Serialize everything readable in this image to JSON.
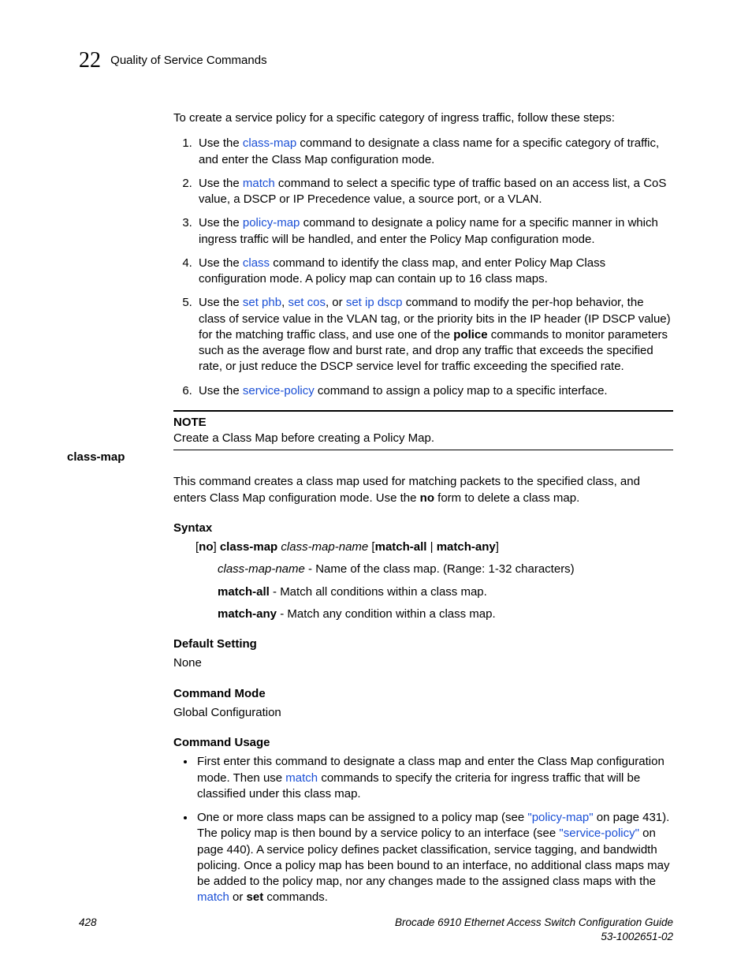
{
  "header": {
    "chapterNumber": "22",
    "title": "Quality of Service Commands"
  },
  "intro": "To create a service policy for a specific category of ingress traffic, follow these steps:",
  "steps": {
    "s1a": "Use the ",
    "s1link": "class-map",
    "s1b": " command to designate a class name for a specific category of traffic, and enter the Class Map configuration mode.",
    "s2a": "Use the ",
    "s2link": "match",
    "s2b": " command to select a specific type of traffic based on an access list, a CoS value, a DSCP or IP Precedence value, a source port, or a VLAN.",
    "s3a": "Use the ",
    "s3link": "policy-map",
    "s3b": " command to designate a policy name for a specific manner in which ingress traffic will be handled, and enter the Policy Map configuration mode.",
    "s4a": "Use the ",
    "s4link": "class",
    "s4b": " command to identify the class map, and enter Policy Map Class configuration mode. A policy map can contain up to 16 class maps.",
    "s5a": "Use the ",
    "s5link1": "set phb",
    "s5sep1": ", ",
    "s5link2": "set cos",
    "s5sep2": ", or ",
    "s5link3": "set ip dscp",
    "s5b": " command to modify the per-hop behavior, the class of service value in the VLAN tag, or the priority bits in the IP header (IP DSCP value) for the matching traffic class, and use one of the ",
    "s5bold": "police",
    "s5c": " commands to monitor parameters such as the average flow and burst rate, and drop any traffic that exceeds the specified rate, or just reduce the DSCP service level for traffic exceeding the specified rate.",
    "s6a": "Use the ",
    "s6link": "service-policy",
    "s6b": " command to assign a policy map to a specific interface."
  },
  "note": {
    "label": "NOTE",
    "text": "Create a Class Map before creating a Policy Map."
  },
  "command": {
    "sidebar": "class-map",
    "desc_a": "This command creates a class map used for matching packets to the specified class, and enters Class Map configuration mode. Use the ",
    "desc_bold": "no",
    "desc_b": " form to delete a class map.",
    "syntax_h": "Syntax",
    "syntax_line": {
      "p1": "[",
      "b1": "no",
      "p2": "] ",
      "b2": "class-map",
      "p3": " ",
      "i1": "class-map-name",
      "p4": " [",
      "b3": "match-all",
      "p5": " | ",
      "b4": "match-any",
      "p6": "]"
    },
    "param1_i": "class-map-name",
    "param1_t": " - Name of the class map. (Range: 1-32 characters)",
    "param2_b": "match-all",
    "param2_t": " - Match all conditions within a class map.",
    "param3_b": "match-any",
    "param3_t": " - Match any condition within a class map.",
    "default_h": "Default Setting",
    "default_t": "None",
    "mode_h": "Command Mode",
    "mode_t": "Global Configuration",
    "usage_h": "Command Usage",
    "usage1_a": "First enter this command to designate a class map and enter the Class Map configuration mode. Then use ",
    "usage1_link": "match",
    "usage1_b": " commands to specify the criteria for ingress traffic that will be classified under this class map.",
    "usage2_a": "One or more class maps can be assigned to a policy map (see ",
    "usage2_link1": "\"policy-map\"",
    "usage2_b": " on page 431). The policy map is then bound by a service policy to an interface (see ",
    "usage2_link2": "\"service-policy\"",
    "usage2_c": " on page 440). A service policy defines packet classification, service tagging, and bandwidth policing. Once a policy map has been bound to an interface, no additional class maps may be added to the policy map, nor any changes made to the assigned class maps with the ",
    "usage2_link3": "match",
    "usage2_d": " or ",
    "usage2_bold": "set",
    "usage2_e": " commands."
  },
  "footer": {
    "page": "428",
    "guide": "Brocade 6910 Ethernet Access Switch Configuration Guide",
    "docnum": "53-1002651-02"
  }
}
